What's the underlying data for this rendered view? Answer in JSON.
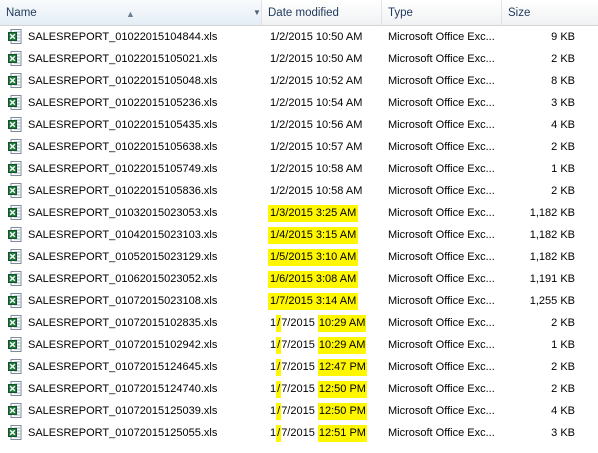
{
  "columns": {
    "name": "Name",
    "date": "Date modified",
    "type": "Type",
    "size": "Size"
  },
  "files": [
    {
      "name": "SALESREPORT_01022015104844.xls",
      "date": "1/2/2015 10:50 AM",
      "type": "Microsoft Office Exc...",
      "size": "9 KB",
      "highlight": "none"
    },
    {
      "name": "SALESREPORT_01022015105021.xls",
      "date": "1/2/2015 10:50 AM",
      "type": "Microsoft Office Exc...",
      "size": "2 KB",
      "highlight": "none"
    },
    {
      "name": "SALESREPORT_01022015105048.xls",
      "date": "1/2/2015 10:52 AM",
      "type": "Microsoft Office Exc...",
      "size": "8 KB",
      "highlight": "none"
    },
    {
      "name": "SALESREPORT_01022015105236.xls",
      "date": "1/2/2015 10:54 AM",
      "type": "Microsoft Office Exc...",
      "size": "3 KB",
      "highlight": "none"
    },
    {
      "name": "SALESREPORT_01022015105435.xls",
      "date": "1/2/2015 10:56 AM",
      "type": "Microsoft Office Exc...",
      "size": "4 KB",
      "highlight": "none"
    },
    {
      "name": "SALESREPORT_01022015105638.xls",
      "date": "1/2/2015 10:57 AM",
      "type": "Microsoft Office Exc...",
      "size": "2 KB",
      "highlight": "none"
    },
    {
      "name": "SALESREPORT_01022015105749.xls",
      "date": "1/2/2015 10:58 AM",
      "type": "Microsoft Office Exc...",
      "size": "1 KB",
      "highlight": "none"
    },
    {
      "name": "SALESREPORT_01022015105836.xls",
      "date": "1/2/2015 10:58 AM",
      "type": "Microsoft Office Exc...",
      "size": "2 KB",
      "highlight": "none"
    },
    {
      "name": "SALESREPORT_01032015023053.xls",
      "date": "1/3/2015 3:25 AM",
      "type": "Microsoft Office Exc...",
      "size": "1,182 KB",
      "highlight": "full"
    },
    {
      "name": "SALESREPORT_01042015023103.xls",
      "date": "1/4/2015 3:15 AM",
      "type": "Microsoft Office Exc...",
      "size": "1,182 KB",
      "highlight": "full"
    },
    {
      "name": "SALESREPORT_01052015023129.xls",
      "date": "1/5/2015 3:10 AM",
      "type": "Microsoft Office Exc...",
      "size": "1,182 KB",
      "highlight": "full"
    },
    {
      "name": "SALESREPORT_01062015023052.xls",
      "date": "1/6/2015 3:08 AM",
      "type": "Microsoft Office Exc...",
      "size": "1,191 KB",
      "highlight": "full"
    },
    {
      "name": "SALESREPORT_01072015023108.xls",
      "date": "1/7/2015 3:14 AM",
      "type": "Microsoft Office Exc...",
      "size": "1,255 KB",
      "highlight": "full"
    },
    {
      "name": "SALESREPORT_01072015102835.xls",
      "date": "1/7/2015 10:29 AM",
      "type": "Microsoft Office Exc...",
      "size": "2 KB",
      "highlight": "partial"
    },
    {
      "name": "SALESREPORT_01072015102942.xls",
      "date": "1/7/2015 10:29 AM",
      "type": "Microsoft Office Exc...",
      "size": "1 KB",
      "highlight": "partial"
    },
    {
      "name": "SALESREPORT_01072015124645.xls",
      "date": "1/7/2015 12:47 PM",
      "type": "Microsoft Office Exc...",
      "size": "2 KB",
      "highlight": "partial"
    },
    {
      "name": "SALESREPORT_01072015124740.xls",
      "date": "1/7/2015 12:50 PM",
      "type": "Microsoft Office Exc...",
      "size": "2 KB",
      "highlight": "partial"
    },
    {
      "name": "SALESREPORT_01072015125039.xls",
      "date": "1/7/2015 12:50 PM",
      "type": "Microsoft Office Exc...",
      "size": "4 KB",
      "highlight": "partial"
    },
    {
      "name": "SALESREPORT_01072015125055.xls",
      "date": "1/7/2015 12:51 PM",
      "type": "Microsoft Office Exc...",
      "size": "3 KB",
      "highlight": "partial"
    }
  ],
  "colors": {
    "highlight": "#fff700",
    "header_text": "#1e395b",
    "excel_green": "#1f7a3c"
  },
  "icons": {
    "file": "excel-file-icon",
    "sort": "sort-ascending-icon",
    "dropdown": "dropdown-arrow-icon"
  }
}
